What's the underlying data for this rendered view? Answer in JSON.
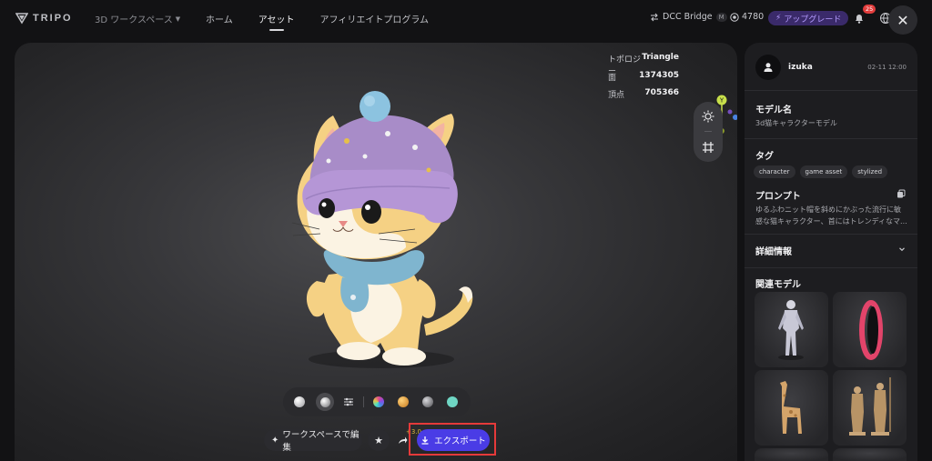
{
  "brand": {
    "name": "TRIPO"
  },
  "header": {
    "workspace_label": "3D ワークスペース",
    "nav": [
      "ホーム",
      "アセット",
      "アフィリエイトプログラム"
    ],
    "dcc_label": "DCC Bridge",
    "dcc_badge": "M",
    "credits": "4780",
    "upgrade_label": "アップグレード",
    "notif_count": "25"
  },
  "stats": {
    "topology_label": "トポロジー",
    "topology_value": "Triangle",
    "faces_label": "面",
    "faces_value": "1374305",
    "vertices_label": "頂点",
    "vertices_value": "705366"
  },
  "gizmo": {
    "y_label": "Y",
    "z_label": "Z",
    "x_label": "X"
  },
  "actions": {
    "edit_label": "ワークスペースで編集",
    "export_label": "エクスポート",
    "plus_badge": "+3.0"
  },
  "materials": [
    "white",
    "clay",
    "settings",
    "rainbow",
    "gold",
    "gray",
    "teal"
  ],
  "colors": {
    "export": "#4a3ce6",
    "highlight": "#e53a3a",
    "teal": "#6fd6c4",
    "gold": "#e2a13a"
  },
  "panel": {
    "username": "izuka",
    "date": "02-11 12:00",
    "model_name_label": "モデル名",
    "model_name": "3d猫キャラクターモデル",
    "tags_label": "タグ",
    "tags": [
      "character",
      "game asset",
      "stylized"
    ],
    "prompt_label": "プロンプト",
    "prompt_line1": "ゆるふわニット帽を斜めにかぶった流行に敏",
    "prompt_line2": "感な猫キャラクター、首にはトレンディなマ...",
    "details_label": "詳細情報",
    "related_label": "関連モデル"
  }
}
